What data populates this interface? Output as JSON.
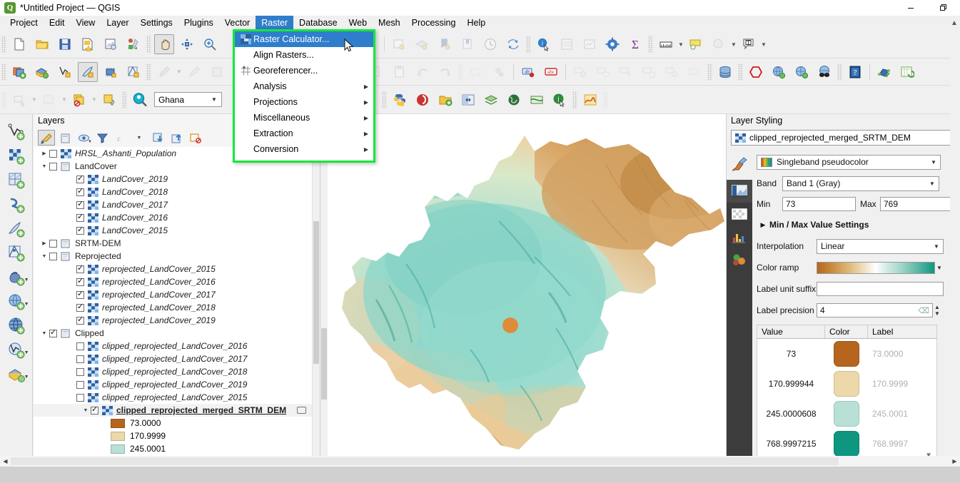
{
  "window": {
    "title": "*Untitled Project — QGIS",
    "app_icon": "qgis-logo-icon",
    "minimize": "–",
    "restore": "❐"
  },
  "menubar": {
    "items": [
      {
        "label": "Project",
        "active": false
      },
      {
        "label": "Edit",
        "active": false
      },
      {
        "label": "View",
        "active": false
      },
      {
        "label": "Layer",
        "active": false
      },
      {
        "label": "Settings",
        "active": false
      },
      {
        "label": "Plugins",
        "active": false
      },
      {
        "label": "Vector",
        "active": false
      },
      {
        "label": "Raster",
        "active": true
      },
      {
        "label": "Database",
        "active": false
      },
      {
        "label": "Web",
        "active": false
      },
      {
        "label": "Mesh",
        "active": false
      },
      {
        "label": "Processing",
        "active": false
      },
      {
        "label": "Help",
        "active": false
      }
    ]
  },
  "raster_menu": {
    "highlight_color": "#14e838",
    "items": [
      {
        "label": "Raster Calculator...",
        "icon": "raster-calculator-icon",
        "selected": true,
        "submenu": false
      },
      {
        "label": "Align Rasters...",
        "icon": "none",
        "selected": false,
        "submenu": false
      },
      {
        "label": "Georeferencer...",
        "icon": "georeferencer-icon",
        "selected": false,
        "submenu": false
      },
      {
        "label": "Analysis",
        "icon": "none",
        "selected": false,
        "submenu": true
      },
      {
        "label": "Projections",
        "icon": "none",
        "selected": false,
        "submenu": true
      },
      {
        "label": "Miscellaneous",
        "icon": "none",
        "selected": false,
        "submenu": true
      },
      {
        "label": "Extraction",
        "icon": "none",
        "selected": false,
        "submenu": true
      },
      {
        "label": "Conversion",
        "icon": "none",
        "selected": false,
        "submenu": true
      }
    ]
  },
  "toolbar_filter": {
    "value": "Ghana",
    "placeholder": "Ghana"
  },
  "layers_panel": {
    "title": "Layers",
    "toolbar": [
      {
        "name": "open-layer-styling-panel",
        "pressed": true
      },
      {
        "name": "add-group"
      },
      {
        "name": "manage-map-themes"
      },
      {
        "name": "filter-legend"
      },
      {
        "name": "filter-legend-by-expression"
      },
      {
        "name": "expand-all"
      },
      {
        "name": "collapse-all"
      },
      {
        "name": "remove-layer-group"
      }
    ],
    "rows": [
      {
        "indent": 0,
        "expander": "collapsed",
        "checkbox": "off",
        "icon": "raster-layer-icon",
        "label": "HRSL_Ashanti_Population",
        "style": "italic"
      },
      {
        "indent": 0,
        "expander": "expanded",
        "checkbox": "off",
        "icon": "group-icon",
        "label": "LandCover",
        "style": "normal"
      },
      {
        "indent": 1,
        "expander": "none",
        "checkbox": "on",
        "icon": "raster-layer-icon",
        "label": "LandCover_2019",
        "style": "italic"
      },
      {
        "indent": 1,
        "expander": "none",
        "checkbox": "on",
        "icon": "raster-layer-icon",
        "label": "LandCover_2018",
        "style": "italic"
      },
      {
        "indent": 1,
        "expander": "none",
        "checkbox": "on",
        "icon": "raster-layer-icon",
        "label": "LandCover_2017",
        "style": "italic"
      },
      {
        "indent": 1,
        "expander": "none",
        "checkbox": "on",
        "icon": "raster-layer-icon",
        "label": "LandCover_2016",
        "style": "italic"
      },
      {
        "indent": 1,
        "expander": "none",
        "checkbox": "on",
        "icon": "raster-layer-icon",
        "label": "LandCover_2015",
        "style": "italic"
      },
      {
        "indent": 0,
        "expander": "collapsed",
        "checkbox": "off",
        "icon": "group-icon",
        "label": "SRTM-DEM",
        "style": "normal"
      },
      {
        "indent": 0,
        "expander": "expanded",
        "checkbox": "off",
        "icon": "group-icon",
        "label": "Reprojected",
        "style": "normal"
      },
      {
        "indent": 1,
        "expander": "none",
        "checkbox": "on",
        "icon": "raster-layer-icon",
        "label": "reprojected_LandCover_2015",
        "style": "italic"
      },
      {
        "indent": 1,
        "expander": "none",
        "checkbox": "on",
        "icon": "raster-layer-icon",
        "label": "reprojected_LandCover_2016",
        "style": "italic"
      },
      {
        "indent": 1,
        "expander": "none",
        "checkbox": "on",
        "icon": "raster-layer-icon",
        "label": "reprojected_LandCover_2017",
        "style": "italic"
      },
      {
        "indent": 1,
        "expander": "none",
        "checkbox": "on",
        "icon": "raster-layer-icon",
        "label": "reprojected_LandCover_2018",
        "style": "italic"
      },
      {
        "indent": 1,
        "expander": "none",
        "checkbox": "on",
        "icon": "raster-layer-icon",
        "label": "reprojected_LandCover_2019",
        "style": "italic"
      },
      {
        "indent": 0,
        "expander": "expanded",
        "checkbox": "on",
        "icon": "group-icon",
        "label": "Clipped",
        "style": "normal"
      },
      {
        "indent": 1,
        "expander": "none",
        "checkbox": "off",
        "icon": "raster-layer-icon",
        "label": "clipped_reprojected_LandCover_2016",
        "style": "italic"
      },
      {
        "indent": 1,
        "expander": "none",
        "checkbox": "off",
        "icon": "raster-layer-icon",
        "label": "clipped_reprojected_LandCover_2017",
        "style": "italic"
      },
      {
        "indent": 1,
        "expander": "none",
        "checkbox": "off",
        "icon": "raster-layer-icon",
        "label": "clipped_reprojected_LandCover_2018",
        "style": "italic"
      },
      {
        "indent": 1,
        "expander": "none",
        "checkbox": "off",
        "icon": "raster-layer-icon",
        "label": "clipped_reprojected_LandCover_2019",
        "style": "italic"
      },
      {
        "indent": 1,
        "expander": "none",
        "checkbox": "off",
        "icon": "raster-layer-icon",
        "label": "clipped_reprojected_LandCover_2015",
        "style": "italic"
      }
    ],
    "selected_layer": {
      "label": "clipped_reprojected_merged_SRTM_DEM",
      "checkbox": "on",
      "expander": "expanded",
      "icon": "raster-layer-icon",
      "legend": [
        {
          "color": "#b5651d",
          "label": "73.0000"
        },
        {
          "color": "#ecd8a8",
          "label": "170.9999"
        },
        {
          "color": "#b8e0d6",
          "label": "245.0001"
        },
        {
          "color": "#0e9680",
          "label": "768.9997"
        }
      ]
    }
  },
  "layer_styling": {
    "title": "Layer Styling",
    "layer_name": "clipped_reprojected_merged_SRTM_DEM",
    "tabs": [
      {
        "name": "symbology-tab",
        "icon": "brush-icon",
        "active": true
      },
      {
        "name": "transparency-tab",
        "icon": "transparency-icon",
        "active": false
      },
      {
        "name": "histogram-tab",
        "icon": "histogram-icon",
        "active": false
      },
      {
        "name": "rendering-tab",
        "icon": "rendering-icon",
        "active": false
      },
      {
        "name": "variables-tab",
        "icon": "variables-icon",
        "active": false
      }
    ],
    "render_type": {
      "label": "Singleband pseudocolor"
    },
    "band": {
      "label": "Band",
      "value": "Band 1 (Gray)"
    },
    "min": {
      "label": "Min",
      "value": "73"
    },
    "max": {
      "label": "Max",
      "value": "769"
    },
    "minmax_settings": "Min / Max Value Settings",
    "interpolation": {
      "label": "Interpolation",
      "value": "Linear"
    },
    "color_ramp": {
      "label": "Color ramp"
    },
    "label_unit_suffix": {
      "label": "Label unit suffix",
      "value": ""
    },
    "label_precision": {
      "label": "Label precision",
      "value": "4"
    },
    "table": {
      "headers": [
        "Value",
        "Color",
        "Label"
      ],
      "rows": [
        {
          "value": "73",
          "color": "#b5651d",
          "label": "73.0000"
        },
        {
          "value": "170.999944",
          "color": "#ecd8a8",
          "label": "170.9999"
        },
        {
          "value": "245.0000608",
          "color": "#b8e0d6",
          "label": "245.0001"
        },
        {
          "value": "768.9997215",
          "color": "#0e9680",
          "label": "768.9997"
        }
      ]
    }
  },
  "statusbar": {
    "text": ""
  }
}
